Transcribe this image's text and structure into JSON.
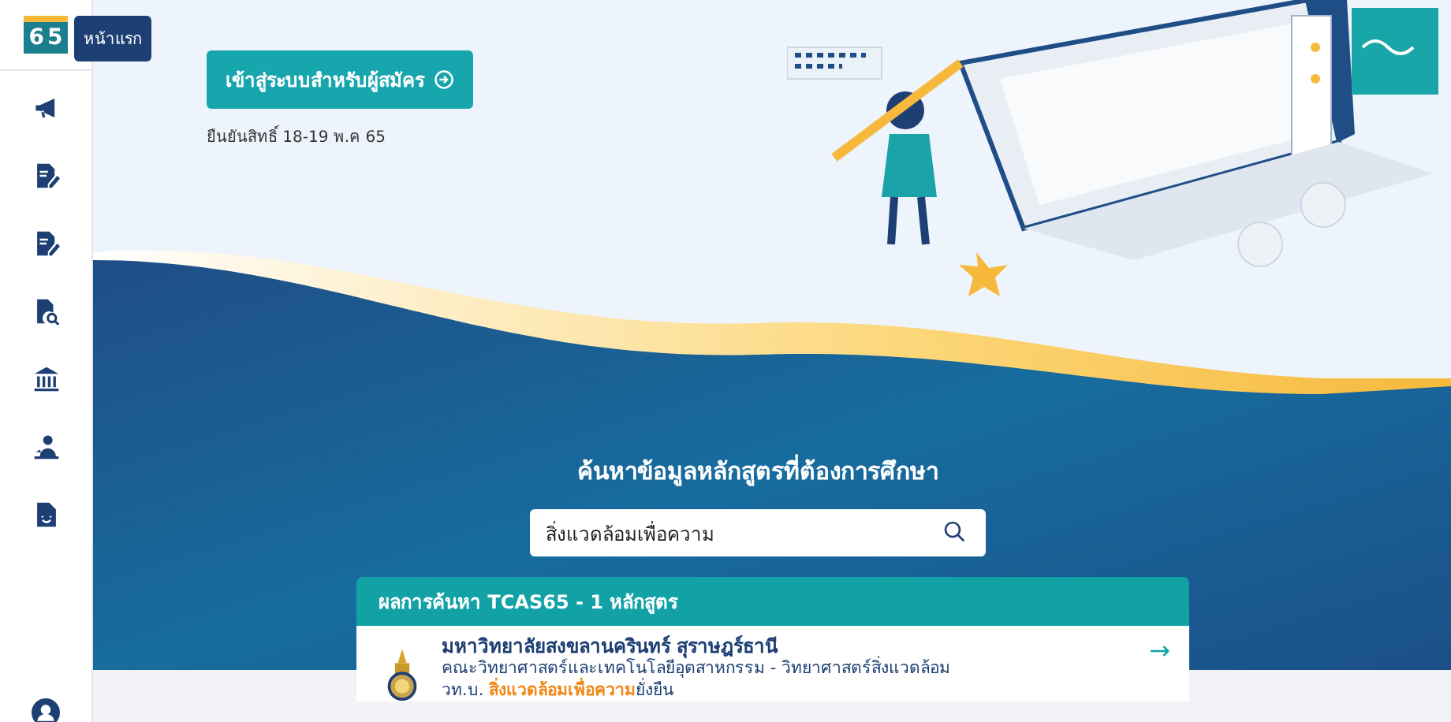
{
  "sidebar": {
    "logo_digits": [
      "6",
      "5"
    ],
    "tooltip": "หน้าแรก",
    "items": [
      {
        "kind": "megaphone"
      },
      {
        "kind": "doc-edit"
      },
      {
        "kind": "doc-edit"
      },
      {
        "kind": "doc-search"
      },
      {
        "kind": "bank"
      },
      {
        "kind": "person-desk"
      },
      {
        "kind": "doc-smile"
      }
    ],
    "bottom_item": {
      "kind": "user"
    }
  },
  "hero": {
    "login_button": "เข้าสู่ระบบสำหรับผู้สมัคร",
    "date_note": "ยืนยันสิทธิ์ 18-19 พ.ค 65"
  },
  "search": {
    "heading": "ค้นหาข้อมูลหลักสูตรที่ต้องการศึกษา",
    "value": "สิ่งแวดล้อมเพื่อความ"
  },
  "results": {
    "header": "ผลการค้นหา TCAS65 - 1 หลักสูตร",
    "items": [
      {
        "university": "มหาวิทยาลัยสงขลานครินทร์ สุราษฎร์ธานี",
        "faculty": "คณะวิทยาศาสตร์และเทคโนโลยีอุตสาหกรรม - วิทยาศาสตร์สิ่งแวดล้อม",
        "program_prefix": "วท.บ. ",
        "program_match": "สิ่งแวดล้อมเพื่อความ",
        "program_suffix": "ยั่งยืน",
        "arrow": "→"
      }
    ]
  }
}
